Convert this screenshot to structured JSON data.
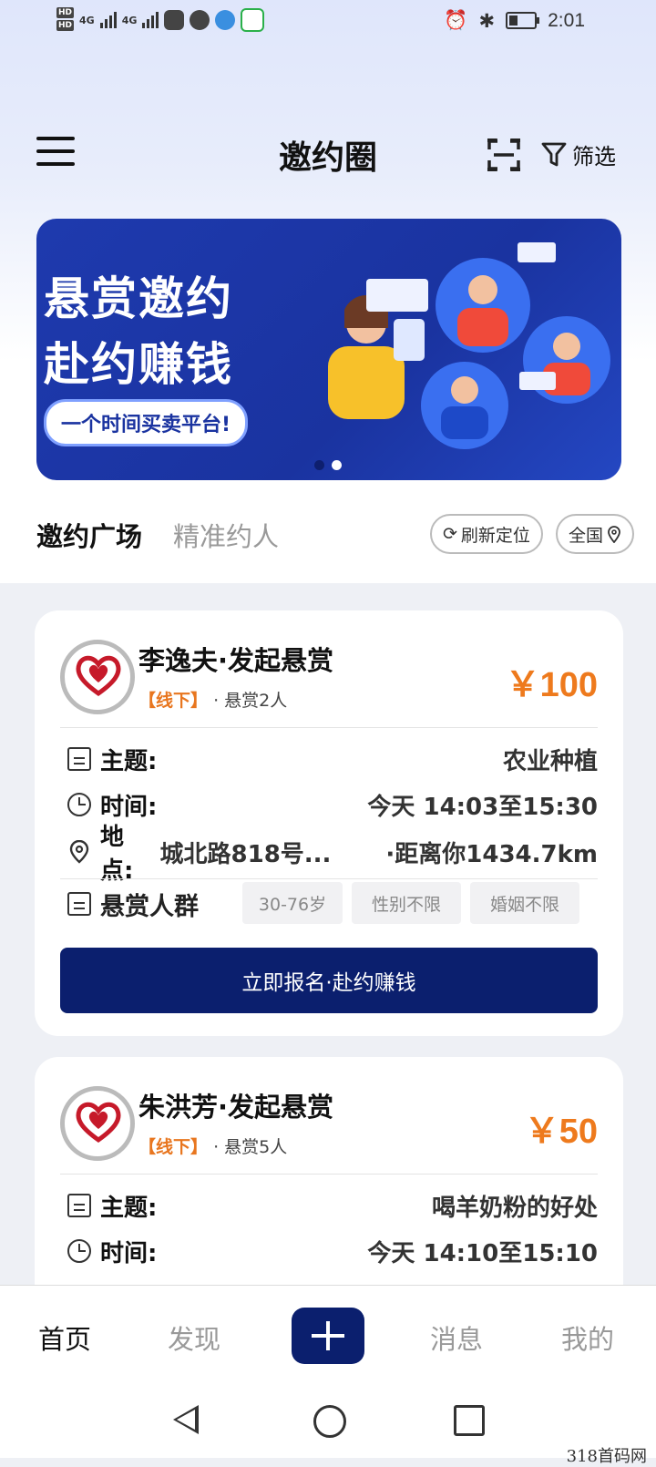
{
  "status_bar": {
    "time": "2:01",
    "hd1": "HD",
    "hd2": "HD",
    "net1": "4G",
    "net2": "4G"
  },
  "header": {
    "title": "邀约圈",
    "filter_label": "筛选"
  },
  "banner": {
    "line1": "悬赏邀约",
    "line2": "赴约赚钱",
    "slogan": "一个时间买卖平台!",
    "pages": 2,
    "active_page": 2
  },
  "tabs": {
    "active": "邀约广场",
    "inactive": "精准约人",
    "refresh_label": "刷新定位",
    "region_label": "全国"
  },
  "labels": {
    "topic": "主题:",
    "time": "时间:",
    "place": "地点:",
    "crowd": "悬赏人群"
  },
  "cards": [
    {
      "name": "李逸夫·发起悬赏",
      "tag": "【线下】",
      "meta": "· 悬赏2人",
      "reward": "￥100",
      "topic": "农业种植",
      "time": "今天 14:03至15:30",
      "address": "城北路818号...",
      "distance": "·距离你1434.7km",
      "crowd": [
        "30-76岁",
        "性别不限",
        "婚姻不限"
      ],
      "button": "立即报名·赴约赚钱"
    },
    {
      "name": "朱洪芳·发起悬赏",
      "tag": "【线下】",
      "meta": "· 悬赏5人",
      "reward": "￥50",
      "topic": "喝羊奶粉的好处",
      "time": "今天 14:10至15:10"
    }
  ],
  "bottom_nav": {
    "home": "首页",
    "discover": "发现",
    "messages": "消息",
    "mine": "我的"
  },
  "watermark": "318首码网"
}
